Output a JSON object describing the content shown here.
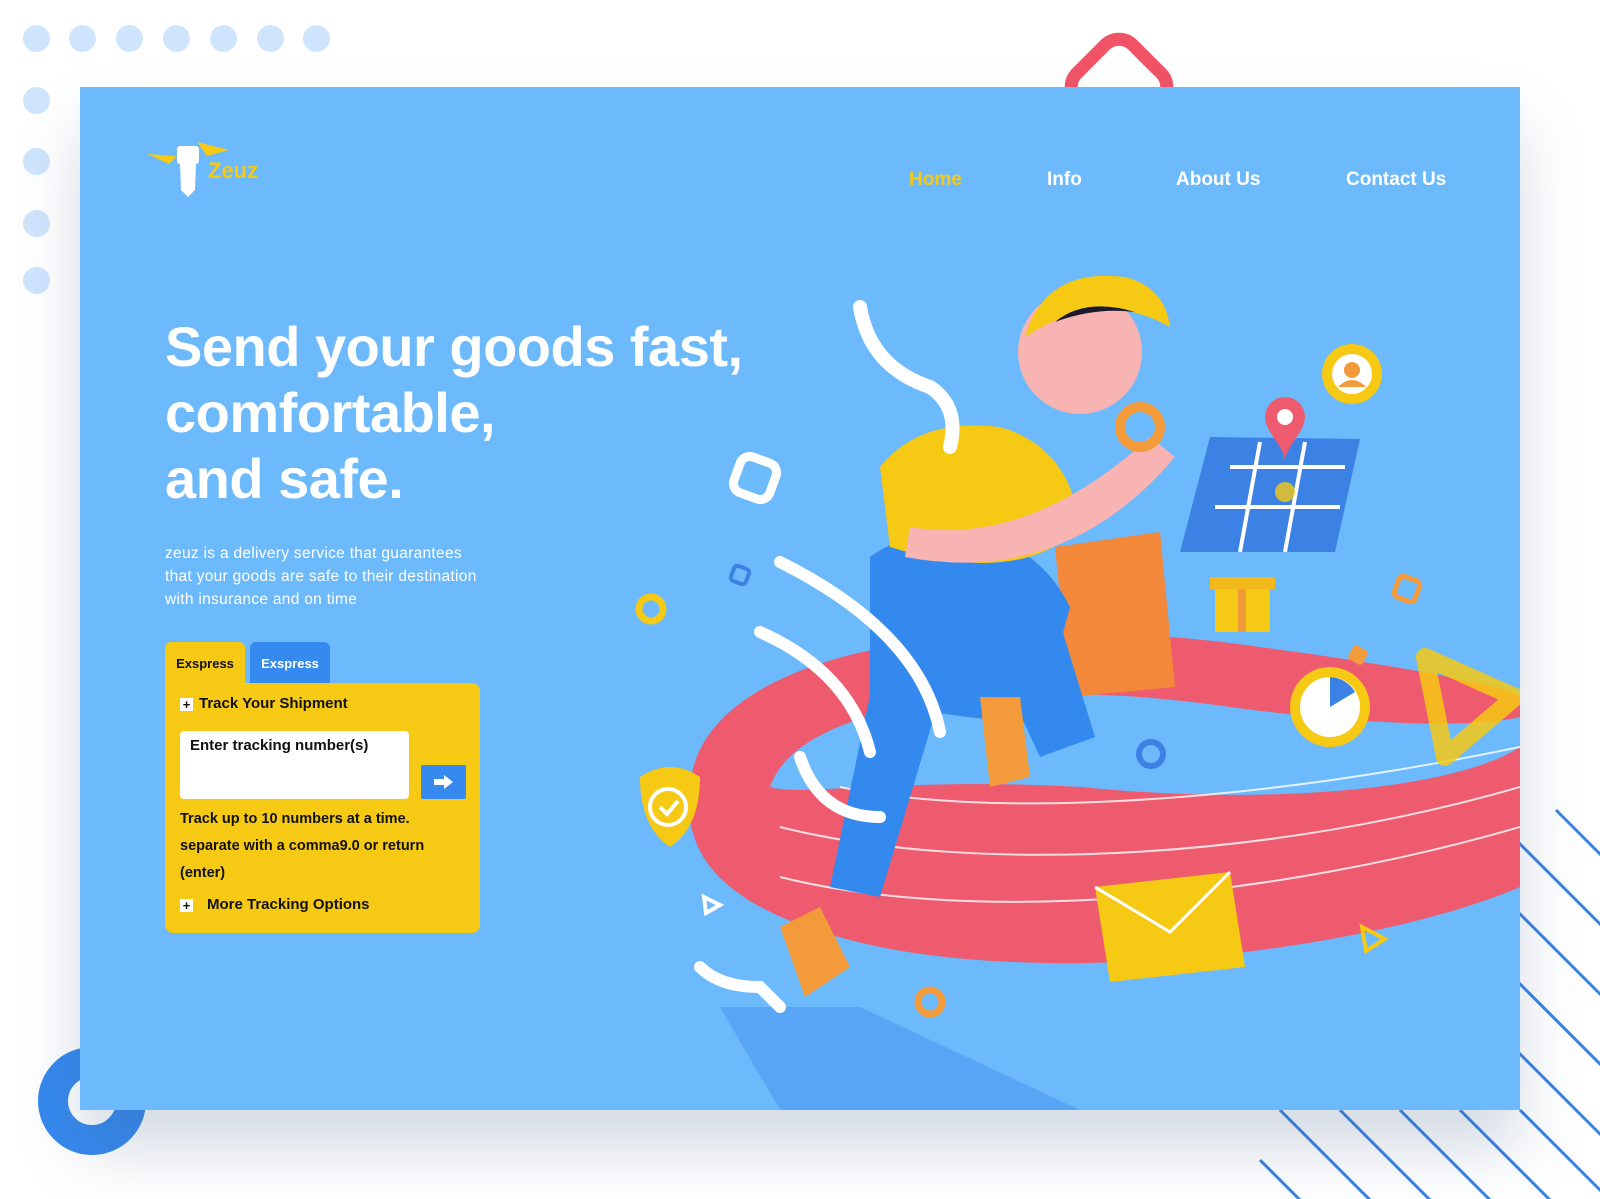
{
  "brand": {
    "name": "Zeuz",
    "colors": {
      "background": "#6cb9fb",
      "accent_yellow": "#f6c914",
      "accent_blue": "#3689ee",
      "accent_red": "#f05366",
      "text": "#ffffff"
    }
  },
  "nav": {
    "items": [
      {
        "label": "Home",
        "active": true
      },
      {
        "label": "Info",
        "active": false
      },
      {
        "label": "About Us",
        "active": false
      },
      {
        "label": "Contact Us",
        "active": false
      }
    ]
  },
  "hero": {
    "headline_lines": [
      "Send your goods fast,",
      "comfortable,",
      "and safe."
    ],
    "description_lines": [
      "zeuz is a delivery service that guarantees",
      "that your goods are safe to their destination",
      "with insurance and on time"
    ],
    "illustration": "delivery-courier-running-with-package"
  },
  "tracking": {
    "tabs": [
      {
        "label": "Exspress",
        "active": true
      },
      {
        "label": "Exspress",
        "active": false
      }
    ],
    "title": "Track Your Shipment",
    "input_placeholder": "Enter tracking number(s)",
    "submit_icon": "arrow-right-icon",
    "note_lines": [
      "Track up to 10 numbers at a time.",
      "separate with a comma9.0 or return",
      "(enter)"
    ],
    "more_options": "More Tracking Options",
    "expand_symbol": "+"
  }
}
